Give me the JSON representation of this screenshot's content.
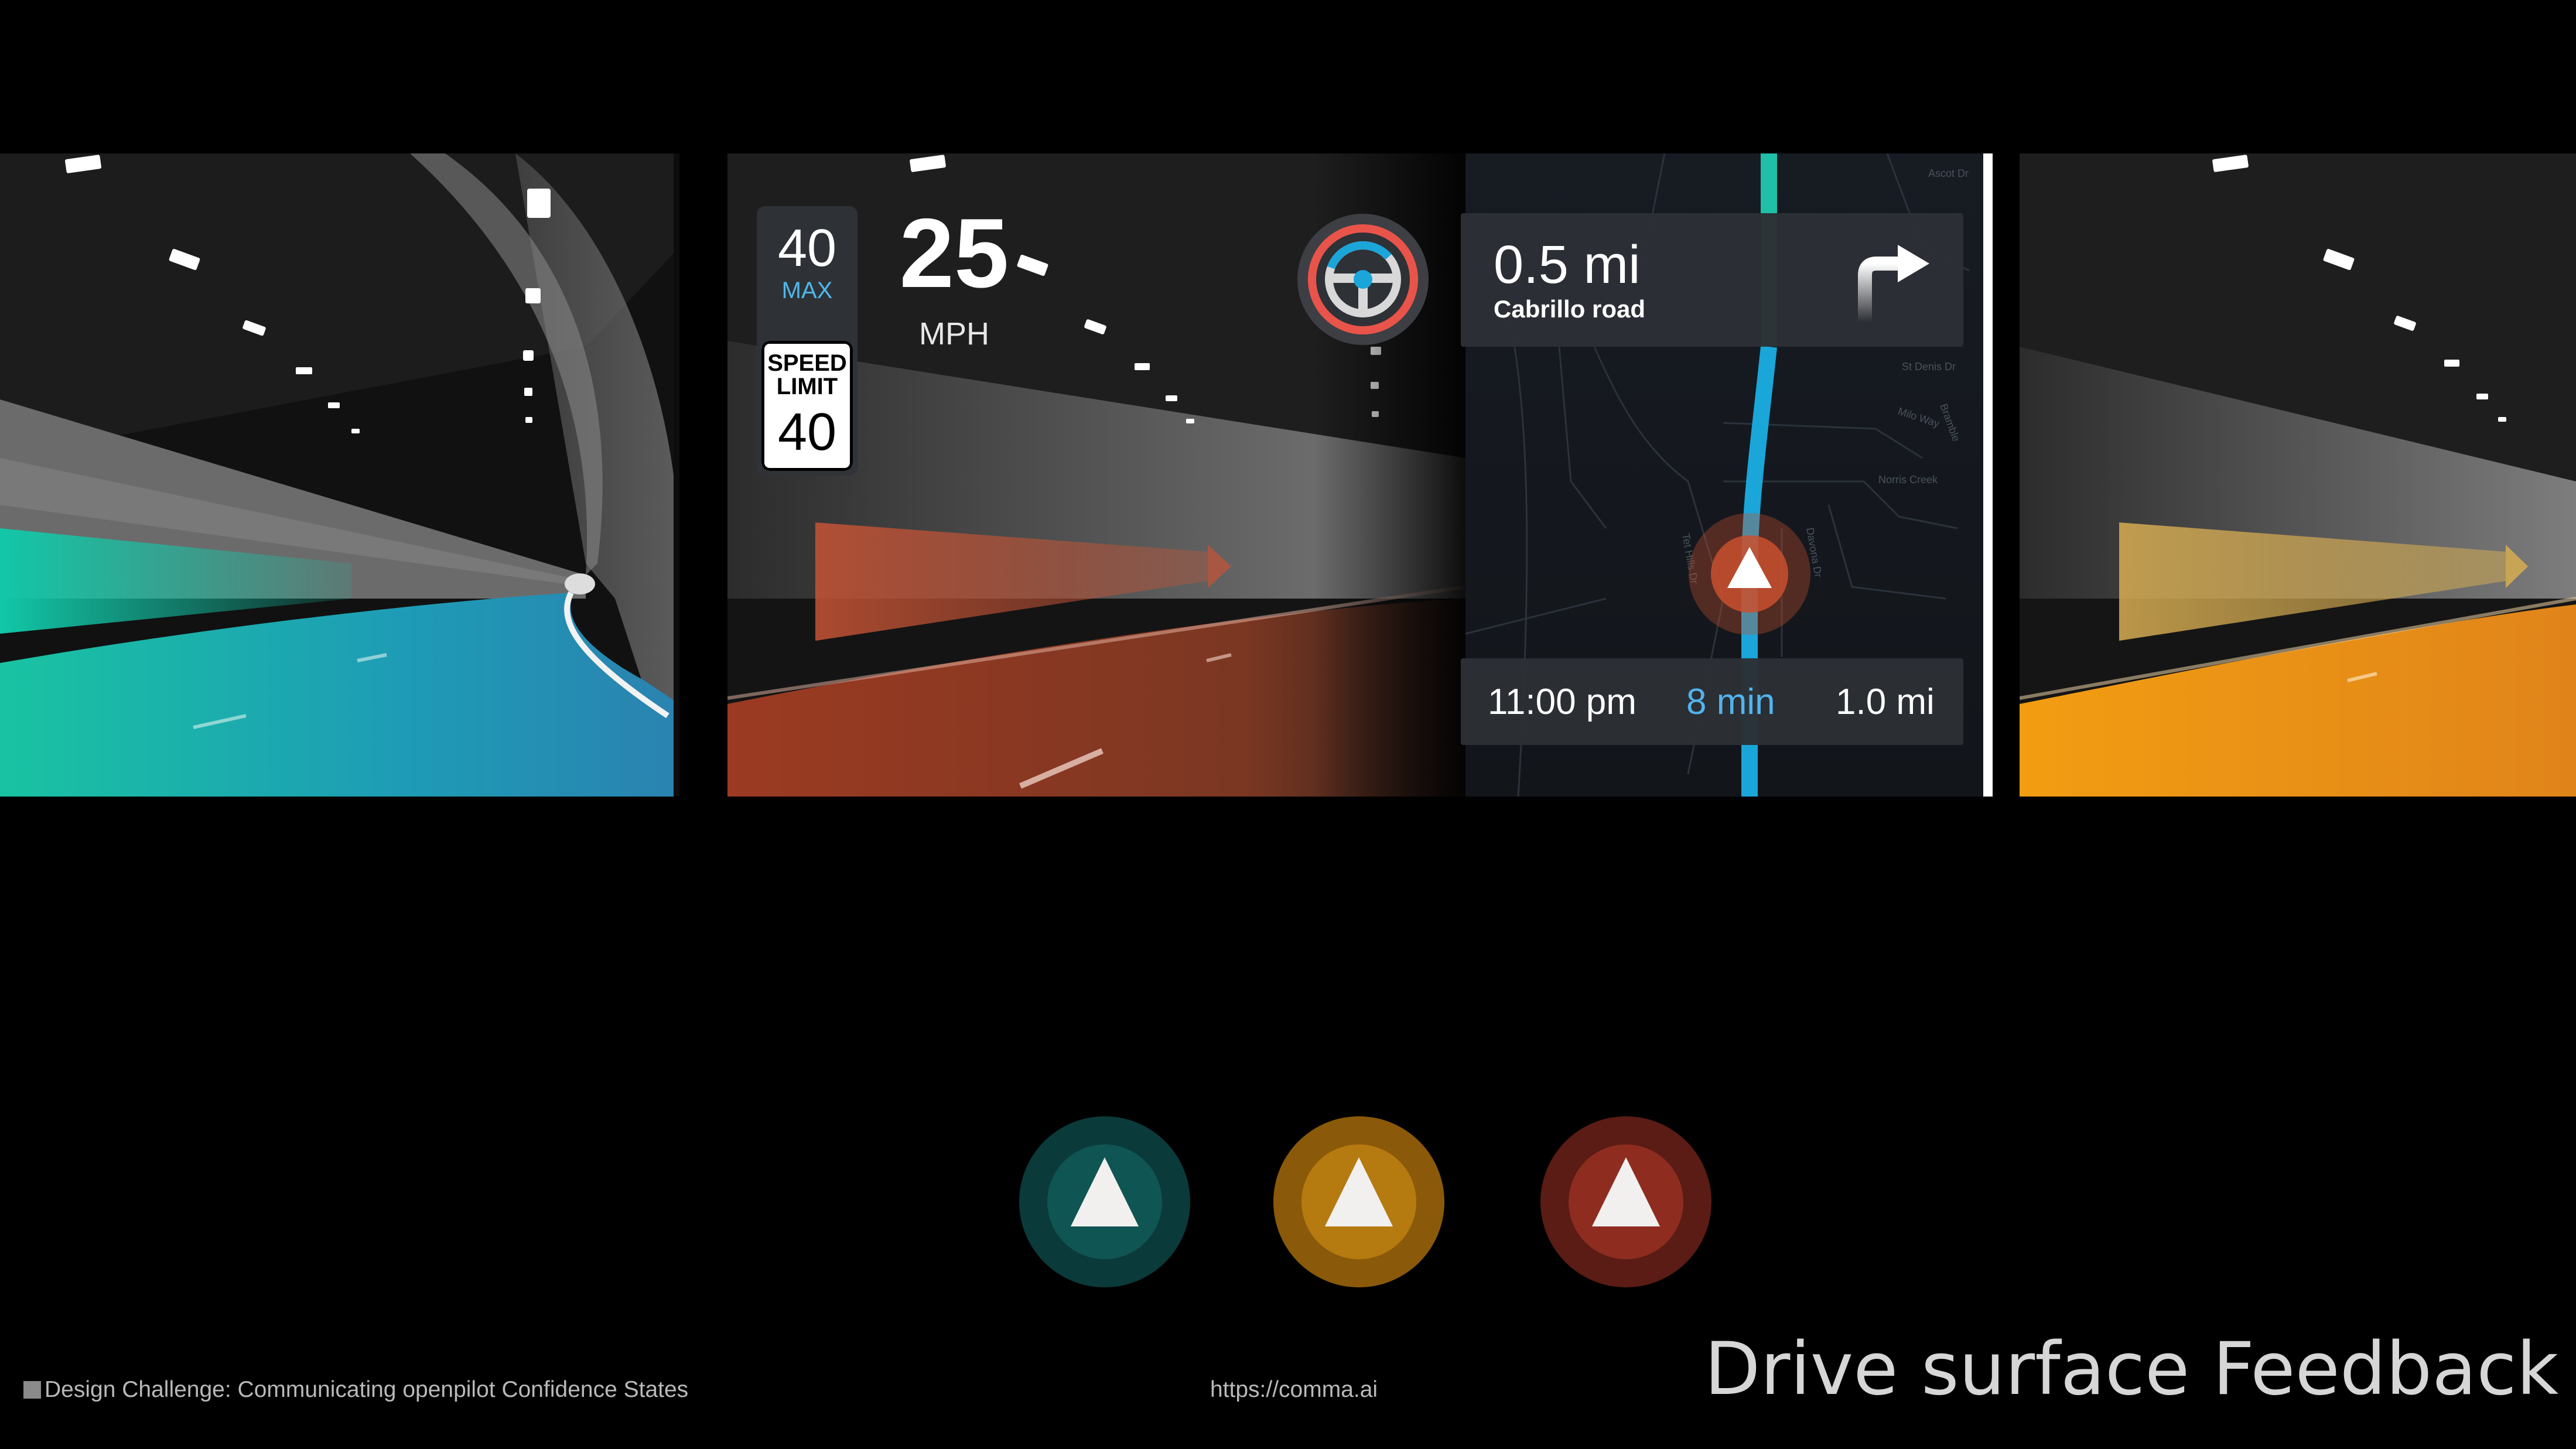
{
  "colors": {
    "background": "#000000",
    "confident_teal": "#1ec3a8",
    "caution_amber": "#f0a31a",
    "alert_red": "#c9502e",
    "nav_route_blue": "#1aa6d9",
    "eta_blue": "#52b3ec"
  },
  "hud": {
    "max_speed": "40",
    "max_label": "MAX",
    "speed_limit_title": "SPEED\nLIMIT",
    "speed_limit_value": "40",
    "current_speed": "25",
    "speed_unit": "MPH",
    "wheel_icon": "steering-wheel-icon"
  },
  "navigation": {
    "distance": "0.5 mi",
    "street": "Cabrillo road",
    "turn_icon": "turn-right-arrow-icon",
    "eta_time": "11:00 pm",
    "eta_minutes": "8 min",
    "eta_distance": "1.0 mi",
    "map_labels": [
      "Ascot Dr",
      "St Denis Dr",
      "Milo Way",
      "Norris Creek",
      "Davona Dr",
      "Tet Hills Dr",
      "Bramble"
    ]
  },
  "panels": {
    "left": {
      "state": "confident",
      "lane_color": "#1ec3a8"
    },
    "center": {
      "state": "alert",
      "lane_color": "#c9502e"
    },
    "right": {
      "state": "caution",
      "lane_color": "#f0a31a"
    }
  },
  "confidence_indicators": [
    {
      "state": "confident",
      "outer": "#0b3a3a",
      "inner": "#0f5553",
      "icon": "triangle-icon"
    },
    {
      "state": "caution",
      "outer": "#8a5a0a",
      "inner": "#b57a10",
      "icon": "triangle-icon"
    },
    {
      "state": "alert",
      "outer": "#5a1c14",
      "inner": "#8e2c20",
      "icon": "triangle-icon"
    }
  ],
  "footer": {
    "challenge": "Design Challenge: Communicating openpilot Confidence States",
    "url": "https://comma.ai",
    "title": "Drive surface Feedback"
  }
}
